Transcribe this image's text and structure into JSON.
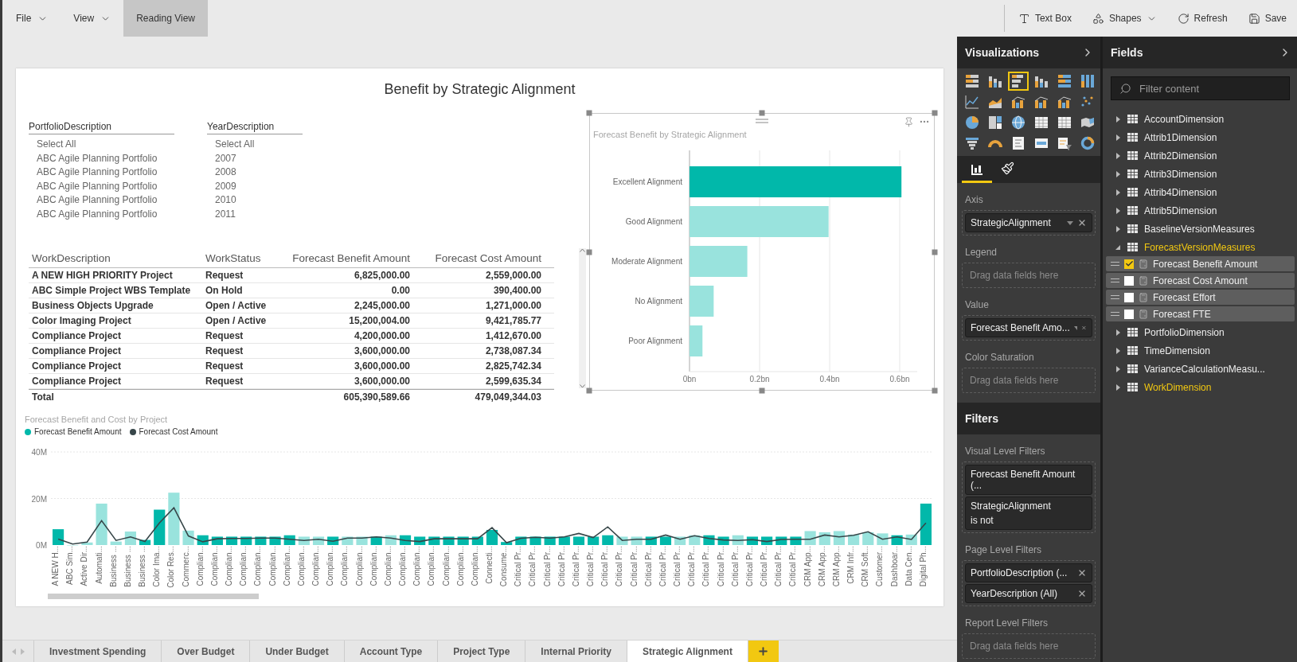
{
  "menu": [
    {
      "label": "File",
      "dropdown": true,
      "selected": false
    },
    {
      "label": "View",
      "dropdown": true,
      "selected": false
    },
    {
      "label": "Reading View",
      "dropdown": false,
      "selected": true
    }
  ],
  "toolbar": [
    {
      "kind": "text-box",
      "label": "Text Box",
      "dropdown": false
    },
    {
      "kind": "shapes",
      "label": "Shapes",
      "dropdown": true
    },
    {
      "kind": "refresh",
      "label": "Refresh",
      "dropdown": false
    },
    {
      "kind": "save",
      "label": "Save",
      "dropdown": false
    }
  ],
  "report": {
    "title": "Benefit by Strategic Alignment",
    "slicers": [
      {
        "header": "PortfolioDescription",
        "items": [
          "Select All",
          "ABC Agile Planning Portfolio",
          "ABC Agile Planning Portfolio",
          "ABC Agile Planning Portfolio",
          "ABC Agile Planning Portfolio",
          "ABC Agile Planning Portfolio"
        ]
      },
      {
        "header": "YearDescription",
        "items": [
          "Select All",
          "2007",
          "2008",
          "2009",
          "2010",
          "2011"
        ]
      }
    ],
    "table": {
      "columns": [
        "WorkDescription",
        "WorkStatus",
        "Forecast Benefit Amount",
        "Forecast Cost Amount"
      ],
      "rows": [
        [
          "A NEW HIGH PRIORITY Project",
          "Request",
          "6,825,000.00",
          "2,559,000.00"
        ],
        [
          "ABC Simple Project WBS Template",
          "On Hold",
          "0.00",
          "390,400.00"
        ],
        [
          "Business Objects Upgrade",
          "Open / Active",
          "2,245,000.00",
          "1,271,000.00"
        ],
        [
          "Color Imaging Project",
          "Open / Active",
          "15,200,004.00",
          "9,421,785.77"
        ],
        [
          "Compliance Project",
          "Request",
          "4,200,000.00",
          "1,412,670.00"
        ],
        [
          "Compliance Project",
          "Request",
          "3,600,000.00",
          "2,738,087.34"
        ],
        [
          "Compliance Project",
          "Request",
          "3,600,000.00",
          "2,825,742.34"
        ],
        [
          "Compliance Project",
          "Request",
          "3,600,000.00",
          "2,599,635.34"
        ]
      ],
      "total": {
        "label": "Total",
        "values": [
          "605,390,589.66",
          "479,049,344.03"
        ]
      }
    },
    "bar_visual": {
      "title": "Forecast Benefit by Strategic Alignment",
      "focused": true,
      "chart_data": {
        "type": "bar",
        "orientation": "horizontal",
        "grid": true,
        "categories": [
          "Excellent Alignment",
          "Good Alignment",
          "Moderate Alignment",
          "No Alignment",
          "Poor Alignment"
        ],
        "series": [
          {
            "color": "#01b8aa",
            "values": [
              0.605,
              null,
              null,
              null,
              null
            ]
          },
          {
            "color": "#99e3dd",
            "values": [
              null,
              0.397,
              0.165,
              0.069,
              0.037
            ]
          }
        ],
        "xlim": [
          0,
          0.65
        ],
        "xticks": [
          {
            "value": 0,
            "label": "0bn"
          },
          {
            "value": 0.2,
            "label": "0.2bn"
          },
          {
            "value": 0.4,
            "label": "0.4bn"
          },
          {
            "value": 0.6,
            "label": "0.6bn"
          }
        ]
      }
    },
    "combo_visual": {
      "title": "Forecast Benefit and Cost by Project",
      "chart_data": {
        "type": "bar",
        "grid": true,
        "categories": [
          "A NEW H...",
          "ABC Sim...",
          "Active Dir...",
          "Automati...",
          "Business ...",
          "Business ...",
          "Business ...",
          "Color Ima...",
          "Color Res...",
          "Commerc...",
          "Complian...",
          "Complian...",
          "Complian...",
          "Complian...",
          "Complian...",
          "Complian...",
          "Complian...",
          "Complian...",
          "Complian...",
          "Complian...",
          "Complian...",
          "Complian...",
          "Complian...",
          "Complian...",
          "Complian...",
          "Complian...",
          "Complian...",
          "Complian...",
          "Complian...",
          "Complian...",
          "Connecti...",
          "Consume...",
          "Critical Pr...",
          "Critical Pr...",
          "Critical Pr...",
          "Critical Pr...",
          "Critical Pr...",
          "Critical Pr...",
          "Critical Pr...",
          "Critical Pr...",
          "Critical Pr...",
          "Critical Pr...",
          "Critical Pr...",
          "Critical Pr...",
          "Critical Pr...",
          "Critical Pr...",
          "Critical Pr...",
          "Critical Pr...",
          "Critical Pr...",
          "Critical Pr...",
          "Critical Pr...",
          "Critical Pr...",
          "CRM App...",
          "CRM App...",
          "CRM App...",
          "CRM Infr...",
          "CRM Soft...",
          "Customer...",
          "Dashboar...",
          "Data Cen...",
          "Digital Ph..."
        ],
        "series": [
          {
            "name": "Forecast Benefit Amount",
            "color": "#01b8aa",
            "type": "bar",
            "values": [
              6.8,
              null,
              null,
              null,
              null,
              null,
              2.2,
              15.2,
              null,
              null,
              4.2,
              3.6,
              3.6,
              3.6,
              3.6,
              3.6,
              4.2,
              null,
              null,
              3.6,
              null,
              null,
              3.6,
              null,
              4.2,
              3.6,
              3.6,
              3.6,
              3.6,
              3.6,
              6.5,
              1.3,
              3.6,
              3.6,
              3.6,
              3.6,
              3.6,
              3.6,
              4.2,
              null,
              null,
              3.6,
              3.6,
              null,
              null,
              4.2,
              3.6,
              null,
              3.6,
              3.6,
              3.6,
              3.6,
              null,
              null,
              null,
              null,
              null,
              null,
              4.2,
              null,
              17.8
            ]
          },
          {
            "color": "#99e3dd",
            "type": "bar",
            "values": [
              null,
              0,
              1.1,
              17.8,
              1.5,
              5.8,
              null,
              null,
              22.5,
              6.2,
              null,
              null,
              null,
              null,
              null,
              null,
              null,
              3.6,
              3.6,
              null,
              3.6,
              3.6,
              null,
              4.2,
              null,
              null,
              null,
              null,
              null,
              null,
              null,
              null,
              null,
              null,
              null,
              null,
              null,
              null,
              null,
              3.6,
              3.6,
              null,
              null,
              3.6,
              4.2,
              null,
              null,
              4.2,
              null,
              null,
              null,
              null,
              6.0,
              5.5,
              6.0,
              4.5,
              5.5,
              5.0,
              null,
              4.5,
              null
            ]
          },
          {
            "name": "Forecast Cost Amount",
            "color": "#374649",
            "type": "line",
            "values": [
              2.6,
              0.4,
              1.3,
              10.5,
              2.0,
              3.5,
              1.5,
              9.5,
              16.0,
              3.9,
              1.4,
              2.7,
              2.8,
              2.8,
              3.0,
              3.0,
              2.5,
              2.0,
              2.5,
              1.6,
              3.0,
              3.0,
              3.5,
              3.0,
              2.0,
              1.5,
              2.7,
              2.7,
              2.7,
              2.7,
              7.5,
              1.0,
              2.9,
              3.3,
              3.0,
              3.5,
              5.0,
              3.2,
              7.8,
              2.0,
              2.5,
              2.5,
              4.3,
              2.5,
              4.0,
              2.8,
              2.2,
              2.0,
              2.3,
              1.5,
              2.4,
              2.5,
              2.5,
              4.3,
              3.5,
              4.2,
              5.7,
              2.5,
              3.5,
              2.4,
              9.5
            ]
          }
        ],
        "ylim": [
          0,
          40
        ],
        "yticks": [
          {
            "value": 0,
            "label": "0M"
          },
          {
            "value": 20,
            "label": "20M"
          },
          {
            "value": 40,
            "label": "40M"
          }
        ]
      }
    }
  },
  "visualizations": {
    "title": "Visualizations",
    "types": [
      {
        "kind": "stacked-bar",
        "selected": false
      },
      {
        "kind": "stacked-column",
        "selected": false
      },
      {
        "kind": "clustered-bar",
        "selected": true
      },
      {
        "kind": "clustered-column",
        "selected": false
      },
      {
        "kind": "percent-bar",
        "selected": false
      },
      {
        "kind": "percent-column",
        "selected": false
      },
      {
        "kind": "line",
        "selected": false
      },
      {
        "kind": "area",
        "selected": false
      },
      {
        "kind": "line-stacked-column",
        "selected": false
      },
      {
        "kind": "line-clustered-column",
        "selected": false
      },
      {
        "kind": "waterfall",
        "selected": false
      },
      {
        "kind": "scatter",
        "selected": false
      },
      {
        "kind": "pie",
        "selected": false
      },
      {
        "kind": "treemap",
        "selected": false
      },
      {
        "kind": "map",
        "selected": false
      },
      {
        "kind": "table",
        "selected": false
      },
      {
        "kind": "matrix",
        "selected": false
      },
      {
        "kind": "filled-map",
        "selected": false
      },
      {
        "kind": "funnel",
        "selected": false
      },
      {
        "kind": "gauge",
        "selected": false
      },
      {
        "kind": "multirow-card",
        "selected": false
      },
      {
        "kind": "card",
        "selected": false
      },
      {
        "kind": "slicer",
        "selected": false
      },
      {
        "kind": "donut",
        "selected": false
      }
    ],
    "tabs": [
      {
        "kind": "fields",
        "selected": true
      },
      {
        "kind": "format",
        "selected": false
      }
    ],
    "wells": [
      {
        "label": "Axis",
        "fields": [
          "StrategicAlignment"
        ]
      },
      {
        "label": "Legend",
        "placeholder": "Drag data fields here"
      },
      {
        "label": "Value",
        "fields": [
          "Forecast Benefit Amo..."
        ]
      },
      {
        "label": "Color Saturation",
        "placeholder": "Drag data fields here"
      }
    ]
  },
  "filters": {
    "title": "Filters",
    "sections": [
      {
        "label": "Visual Level Filters",
        "cards": [
          {
            "lines": [
              "Forecast Benefit Amount (..."
            ],
            "removable": false
          },
          {
            "lines": [
              "StrategicAlignment",
              "is not"
            ],
            "removable": false
          }
        ]
      },
      {
        "label": "Page Level Filters",
        "cards": [
          {
            "lines": [
              "PortfolioDescription (..."
            ],
            "removable": true
          },
          {
            "lines": [
              "YearDescription (All)"
            ],
            "removable": true
          }
        ]
      },
      {
        "label": "Report Level Filters",
        "placeholder": "Drag data fields here"
      }
    ]
  },
  "fields": {
    "title": "Fields",
    "search_placeholder": "Filter content",
    "tables": [
      {
        "name": "AccountDimension",
        "expanded": false,
        "used": false
      },
      {
        "name": "Attrib1Dimension",
        "expanded": false,
        "used": false
      },
      {
        "name": "Attrib2Dimension",
        "expanded": false,
        "used": false
      },
      {
        "name": "Attrib3Dimension",
        "expanded": false,
        "used": false
      },
      {
        "name": "Attrib4Dimension",
        "expanded": false,
        "used": false
      },
      {
        "name": "Attrib5Dimension",
        "expanded": false,
        "used": false
      },
      {
        "name": "BaselineVersionMeasures",
        "expanded": false,
        "used": false
      },
      {
        "name": "ForecastVersionMeasures",
        "expanded": true,
        "used": true,
        "children": [
          {
            "name": "Forecast Benefit Amount",
            "checked": true
          },
          {
            "name": "Forecast Cost Amount",
            "checked": false
          },
          {
            "name": "Forecast Effort",
            "checked": false
          },
          {
            "name": "Forecast FTE",
            "checked": false
          }
        ]
      },
      {
        "name": "PortfolioDimension",
        "expanded": false,
        "used": false
      },
      {
        "name": "TimeDimension",
        "expanded": false,
        "used": false
      },
      {
        "name": "VarianceCalculationMeasu...",
        "expanded": false,
        "used": false
      },
      {
        "name": "WorkDimension",
        "expanded": false,
        "used": true
      }
    ]
  },
  "tabs": [
    {
      "label": "Investment Spending",
      "selected": false
    },
    {
      "label": "Over Budget",
      "selected": false
    },
    {
      "label": "Under Budget",
      "selected": false
    },
    {
      "label": "Account Type",
      "selected": false
    },
    {
      "label": "Project Type",
      "selected": false
    },
    {
      "label": "Internal Priority",
      "selected": false
    },
    {
      "label": "Strategic Alignment",
      "selected": true
    }
  ]
}
